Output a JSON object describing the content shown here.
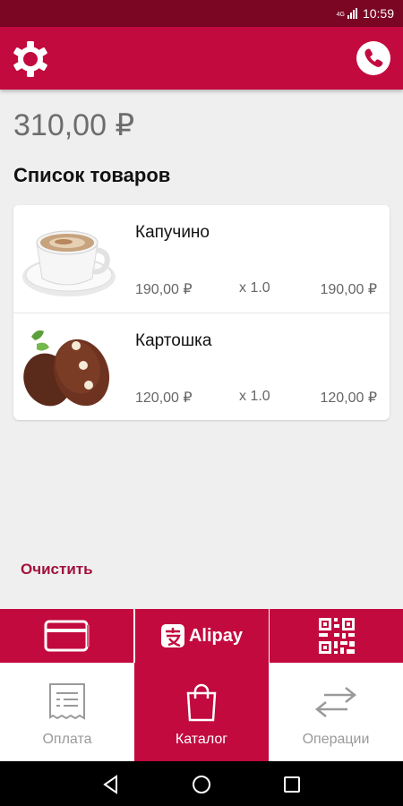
{
  "status": {
    "time": "10:59",
    "network": "4G"
  },
  "colors": {
    "primary": "#c20a3e",
    "status_bar": "#7a0624",
    "accent_text": "#a0123c"
  },
  "header": {
    "left_icon": "gear-icon",
    "right_icon": "phone-icon"
  },
  "cart": {
    "total": "310,00 ₽",
    "title": "Список товаров",
    "items": [
      {
        "name": "Капучино",
        "price": "190,00 ₽",
        "qty": "x 1.0",
        "sum": "190,00 ₽",
        "icon": "cappuccino-image"
      },
      {
        "name": "Картошка",
        "price": "120,00 ₽",
        "qty": "x 1.0",
        "sum": "120,00 ₽",
        "icon": "kartoshka-cake-image"
      }
    ],
    "clear_label": "Очистить"
  },
  "payment_methods": {
    "card_icon": "card-icon",
    "alipay_label": "Alipay",
    "qr_icon": "qr-code-icon"
  },
  "tabs": [
    {
      "label": "Оплата",
      "icon": "receipt-icon",
      "active": false
    },
    {
      "label": "Каталог",
      "icon": "shopping-bag-icon",
      "active": true
    },
    {
      "label": "Операции",
      "icon": "transfer-arrows-icon",
      "active": false
    }
  ],
  "system_nav": [
    "back-icon",
    "home-icon",
    "recents-icon"
  ]
}
